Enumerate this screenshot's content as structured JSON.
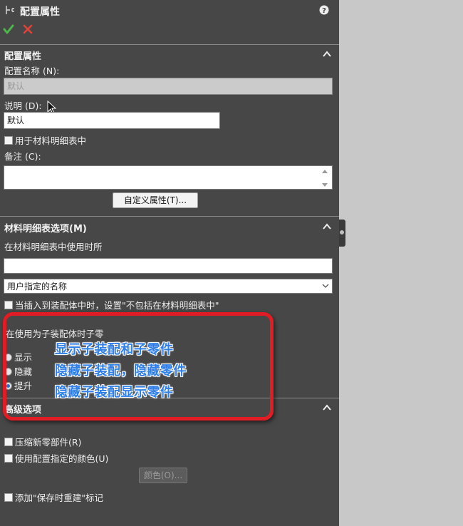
{
  "header": {
    "title": "配置属性"
  },
  "toolbar": {
    "ok_icon": "checkmark-icon",
    "cancel_icon": "x-icon"
  },
  "config_section": {
    "title": "配置属性",
    "name_label": "配置名称 (N):",
    "name_value": "默认",
    "desc_label": "说明 (D):",
    "desc_value": "默认",
    "bom_checkbox_label": "用于材料明细表中",
    "notes_label": "备注 (C):",
    "notes_value": "",
    "custom_props_button": "自定义属性(T)..."
  },
  "bom_section": {
    "title": "材料明细表选项(M)",
    "used_label": "在材料明细表中使用时所",
    "used_value": "",
    "select_value": "用户指定的名称",
    "insert_checkbox_label": "当插入到装配体中时，设置\"不包括在材料明细表中\"",
    "child_label": "在使用为子装配体时子零",
    "radio_options": [
      "显示",
      "隐藏",
      "提升"
    ],
    "selected_radio": "提升"
  },
  "annotation": {
    "lines": [
      "显示子装配和子零件",
      "隐藏子装配，隐藏零件",
      "隐藏子装配显示零件"
    ]
  },
  "advanced_section": {
    "title": "高级选项",
    "compress_label": "压缩新零部件(R)",
    "color_label": "使用配置指定的颜色(U)",
    "color_button": "颜色(O)...",
    "rebuild_label": "添加\"保存时重建\"标记"
  }
}
